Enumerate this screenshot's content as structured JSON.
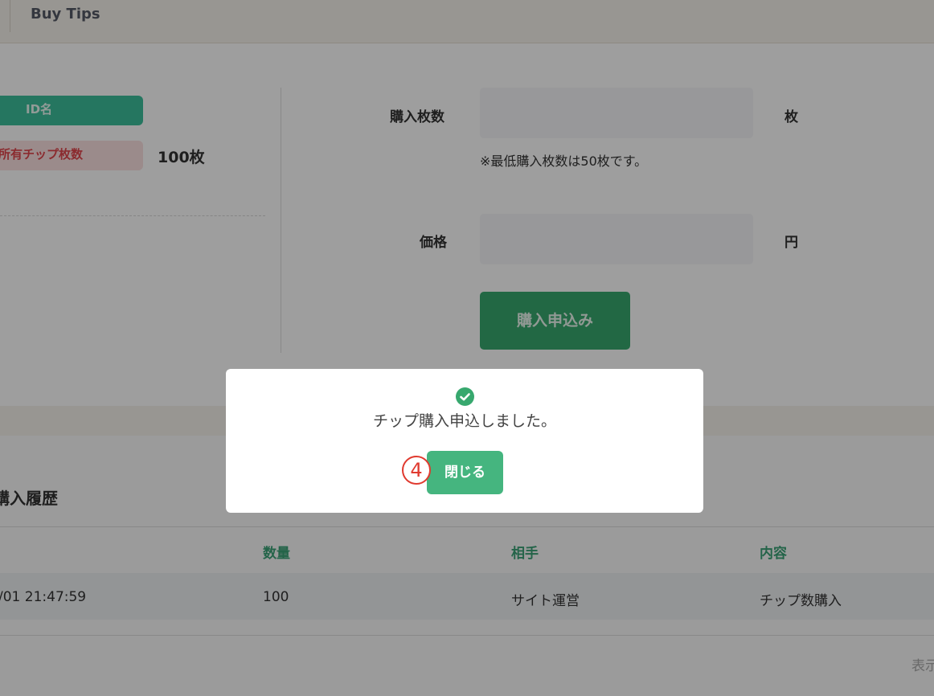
{
  "header": {
    "title": "Buy Tips"
  },
  "profile": {
    "id_label": "ID名",
    "chip_label": "所有チップ枚数",
    "chip_count": "100枚"
  },
  "form": {
    "quantity_label": "購入枚数",
    "quantity_unit": "枚",
    "quantity_value": "",
    "min_note": "※最低購入枚数は50枚です。",
    "price_label": "価格",
    "price_unit": "円",
    "price_value": "",
    "submit_label": "購入申込み"
  },
  "history": {
    "title": "購入履歴",
    "columns": [
      "数量",
      "相手",
      "内容"
    ],
    "rows": [
      {
        "date": "/01 21:47:59",
        "quantity": "100",
        "partner": "サイト運営",
        "content": "チップ数購入"
      }
    ],
    "display_text": "表示"
  },
  "modal": {
    "icon": "check-circle-icon",
    "message": "チップ購入申込しました。",
    "close_label": "閉じる",
    "step_marker": "4"
  },
  "colors": {
    "accent_green": "#37a86e",
    "teal_badge": "#3dbf9b",
    "pink_badge": "#fbe0e0",
    "marker_red": "#e03a2f"
  }
}
